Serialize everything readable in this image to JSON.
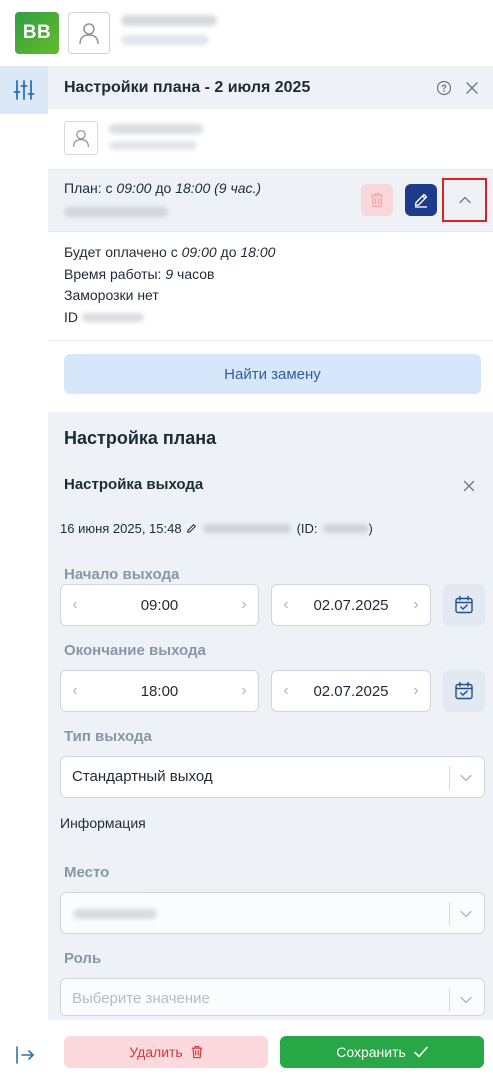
{
  "app": {
    "logo_text": "BB"
  },
  "panel": {
    "title": "Настройки плана - 2 июля 2025",
    "help_icon": "help-circle-icon",
    "close_icon": "close-icon"
  },
  "plan_summary": {
    "prefix": "План: с ",
    "start": "09:00",
    "to_word": " до ",
    "end": "18:00",
    "duration": " (9 час.)"
  },
  "details": {
    "paid_prefix": "Будет оплачено с ",
    "paid_start": "09:00",
    "paid_mid": " до ",
    "paid_end": "18:00",
    "work_prefix": "Время работы: ",
    "work_hours": "9",
    "work_suffix": " часов",
    "freeze": "Заморозки нет",
    "id_label": "ID"
  },
  "find_replacement_label": "Найти замену",
  "settings": {
    "title": "Настройка плана",
    "exit_title": "Настройка выхода",
    "audit_date": "16 июня 2025, 15:48",
    "audit_id_prefix": "(ID:",
    "audit_id_suffix": ")",
    "start_label": "Начало выхода",
    "start_time": "09:00",
    "start_date": "02.07.2025",
    "end_label": "Окончание выхода",
    "end_time": "18:00",
    "end_date": "02.07.2025",
    "type_label": "Тип выхода",
    "type_value": "Стандартный выход",
    "info_label": "Информация",
    "place_label": "Место",
    "role_label": "Роль",
    "role_placeholder": "Выберите значение"
  },
  "actions": {
    "delete_label": "Удалить",
    "save_label": "Сохранить"
  },
  "colors": {
    "accent_blue": "#1e3a8a",
    "save_green": "#27a745",
    "delete_red": "#d9363e",
    "highlight_red": "#e0201c"
  }
}
